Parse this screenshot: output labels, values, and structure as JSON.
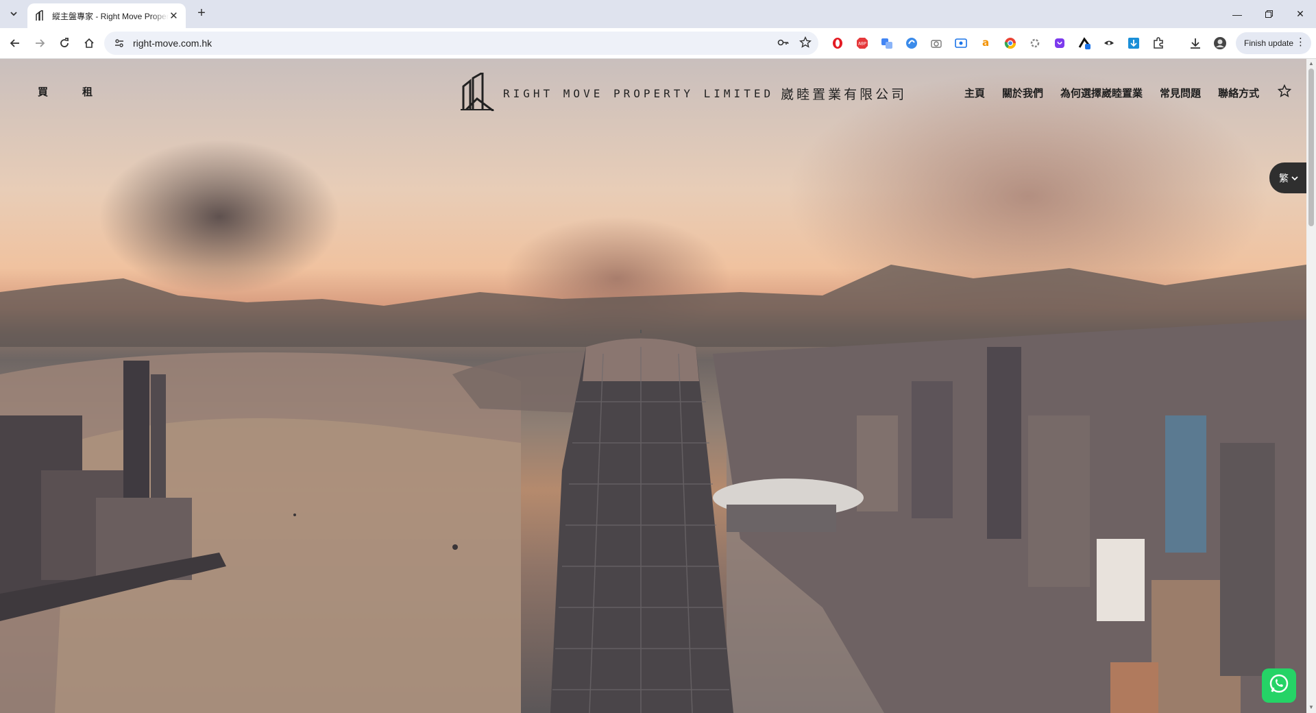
{
  "browser": {
    "tab_title": "縱主盤專家 - Right Move Property",
    "url": "right-move.com.hk",
    "finish_update_label": "Finish update"
  },
  "site": {
    "left_nav": [
      {
        "label": "買"
      },
      {
        "label": "租"
      }
    ],
    "brand_en": "RIGHT MOVE PROPERTY LIMITED",
    "brand_cn": "崴睦置業有限公司",
    "right_nav": [
      {
        "label": "主頁"
      },
      {
        "label": "關於我們"
      },
      {
        "label": "為何選擇崴睦置業"
      },
      {
        "label": "常見問題"
      },
      {
        "label": "聯絡方式"
      }
    ],
    "lang_label": "繁"
  },
  "icons": {
    "extensions": [
      "opera-icon",
      "adblock-icon",
      "translate-icon",
      "sync-icon",
      "camera-icon",
      "screen-capture-icon",
      "amazon-icon",
      "chrome-color-icon",
      "settings-puzzle-icon",
      "shield-icon",
      "profile-ext-icon",
      "spy-icon",
      "download-ext-icon",
      "extensions-puzzle-icon",
      "downloads-icon",
      "profile-avatar-icon"
    ]
  },
  "colors": {
    "whatsapp": "#25d366",
    "lang_button_bg": "#2f2f2f",
    "tab_strip": "#dfe3ee"
  }
}
